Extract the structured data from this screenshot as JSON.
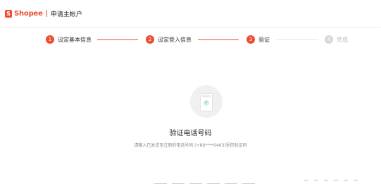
{
  "header": {
    "brand": "Shopee",
    "logo_letter": "S",
    "page_heading": "申请主帐户"
  },
  "stepper": {
    "steps": [
      {
        "num": "1",
        "label": "设定基本信息",
        "state": "done"
      },
      {
        "num": "2",
        "label": "设定登入信息",
        "state": "done"
      },
      {
        "num": "3",
        "label": "验证",
        "state": "active"
      },
      {
        "num": "4",
        "label": "完成",
        "state": "pending"
      }
    ]
  },
  "verification": {
    "title": "验证电话号码",
    "subtitle": "请输入已发送至注册的电话号码 (+86****0463)里的验证码",
    "icon": "phone-check-icon",
    "code_length": 6
  },
  "colors": {
    "accent": "#ee4d2d",
    "pending": "#d8d8d8",
    "check": "#2fb35b"
  }
}
